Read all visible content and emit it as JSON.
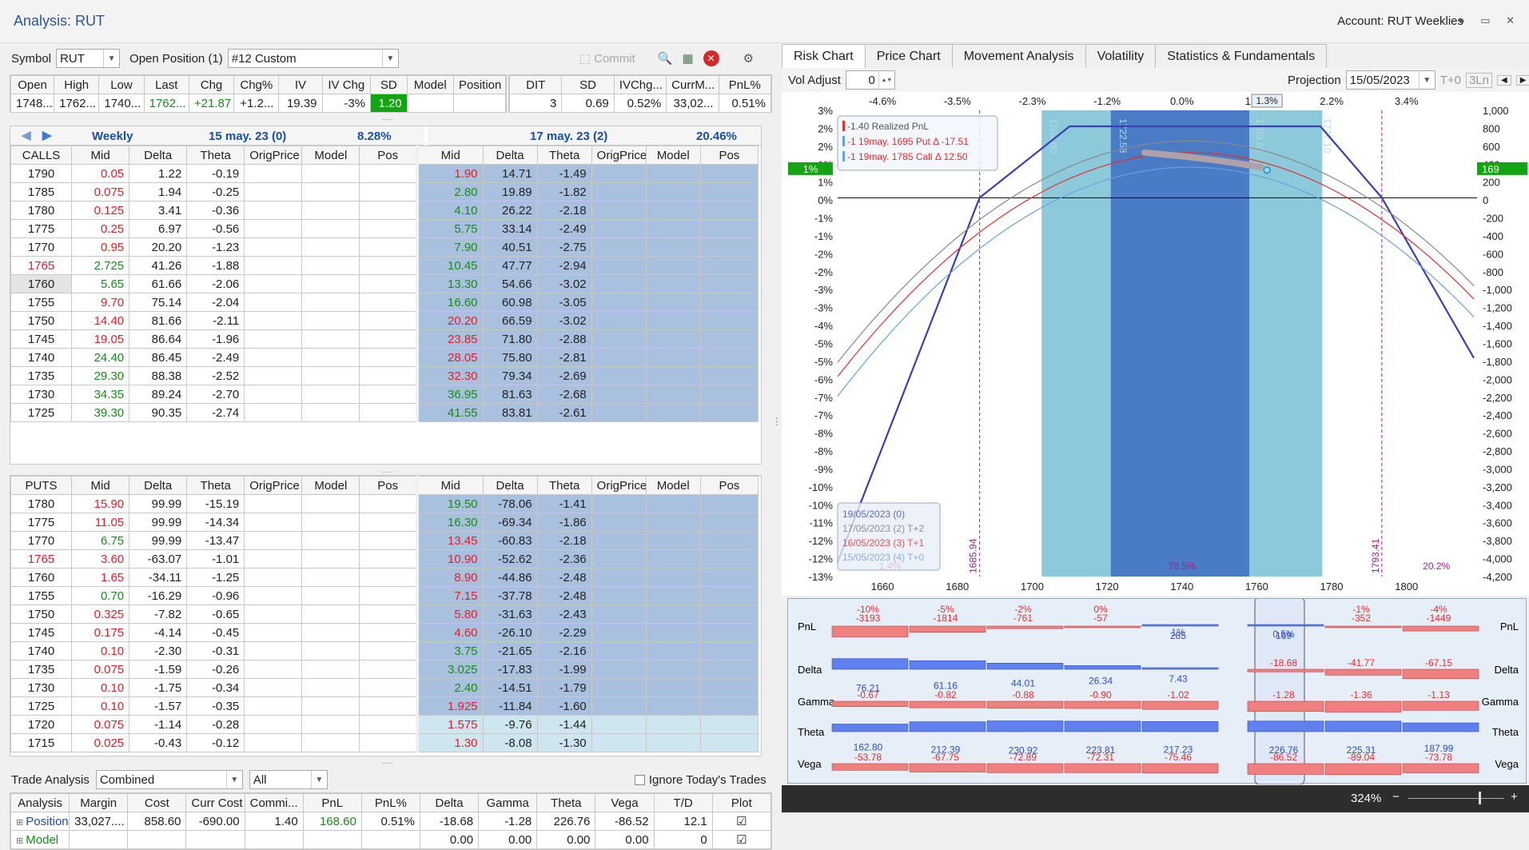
{
  "window": {
    "title": "Analysis: RUT",
    "account": "Account: RUT Weeklies"
  },
  "symbol_bar": {
    "symbol_label": "Symbol",
    "symbol": "RUT",
    "open_pos_label": "Open Position (1)",
    "position": "#12 Custom",
    "commit": "Commit"
  },
  "quote": {
    "headers": [
      "Open",
      "High",
      "Low",
      "Last",
      "Chg",
      "Chg%",
      "IV",
      "IV Chg",
      "SD",
      "Model",
      "Position"
    ],
    "values": [
      "1748...",
      "1762...",
      "1740...",
      "1762...",
      "+21.87",
      "+1.2...",
      "19.39",
      "-3%",
      "1.20",
      "",
      ""
    ]
  },
  "pos_stats": {
    "headers": [
      "DIT",
      "SD",
      "IVChg...",
      "CurrM...",
      "PnL%"
    ],
    "values": [
      "3",
      "0.69",
      "0.52%",
      "33,02...",
      "0.51%"
    ]
  },
  "expiry1": {
    "label": "Weekly",
    "date": "15 may. 23 (0)",
    "iv": "8.28%"
  },
  "expiry2": {
    "date": "17 may. 23 (2)",
    "iv": "20.46%"
  },
  "chain_headers_calls": [
    "CALLS",
    "Mid",
    "Delta",
    "Theta",
    "OrigPrice",
    "Model",
    "Pos"
  ],
  "chain_headers_puts": [
    "PUTS",
    "Mid",
    "Delta",
    "Theta",
    "OrigPrice",
    "Model",
    "Pos"
  ],
  "chain_headers2": [
    "Mid",
    "Delta",
    "Theta",
    "OrigPrice",
    "Model",
    "Pos"
  ],
  "calls": [
    [
      "1790",
      "0.05",
      "1.22",
      "-0.19",
      "1.90",
      "14.71",
      "-1.49"
    ],
    [
      "1785",
      "0.075",
      "1.94",
      "-0.25",
      "2.80",
      "19.89",
      "-1.82"
    ],
    [
      "1780",
      "0.125",
      "3.41",
      "-0.36",
      "4.10",
      "26.22",
      "-2.18"
    ],
    [
      "1775",
      "0.25",
      "6.97",
      "-0.56",
      "5.75",
      "33.14",
      "-2.49"
    ],
    [
      "1770",
      "0.95",
      "20.20",
      "-1.23",
      "7.90",
      "40.51",
      "-2.75"
    ],
    [
      "1765",
      "2.725",
      "41.26",
      "-1.88",
      "10.45",
      "47.77",
      "-2.94"
    ],
    [
      "1760",
      "5.65",
      "61.66",
      "-2.06",
      "13.30",
      "54.66",
      "-3.02"
    ],
    [
      "1755",
      "9.70",
      "75.14",
      "-2.04",
      "16.60",
      "60.98",
      "-3.05"
    ],
    [
      "1750",
      "14.40",
      "81.66",
      "-2.11",
      "20.20",
      "66.59",
      "-3.02"
    ],
    [
      "1745",
      "19.05",
      "86.64",
      "-1.96",
      "23.85",
      "71.80",
      "-2.88"
    ],
    [
      "1740",
      "24.40",
      "86.45",
      "-2.49",
      "28.05",
      "75.80",
      "-2.81"
    ],
    [
      "1735",
      "29.30",
      "88.38",
      "-2.52",
      "32.30",
      "79.34",
      "-2.69"
    ],
    [
      "1730",
      "34.35",
      "89.24",
      "-2.70",
      "36.95",
      "81.63",
      "-2.68"
    ],
    [
      "1725",
      "39.30",
      "90.35",
      "-2.74",
      "41.55",
      "83.81",
      "-2.61"
    ]
  ],
  "calls_colors": [
    "r",
    "r",
    "r",
    "r",
    "r",
    "g",
    "g",
    "r",
    "r",
    "r",
    "g",
    "g",
    "g",
    "g"
  ],
  "calls_colors2": [
    "r",
    "g",
    "g",
    "g",
    "g",
    "g",
    "g",
    "g",
    "r",
    "r",
    "r",
    "r",
    "g",
    "g"
  ],
  "puts": [
    [
      "1780",
      "15.90",
      "99.99",
      "-15.19",
      "19.50",
      "-78.06",
      "-1.41"
    ],
    [
      "1775",
      "11.05",
      "99.99",
      "-14.34",
      "16.30",
      "-69.34",
      "-1.86"
    ],
    [
      "1770",
      "6.75",
      "99.99",
      "-13.47",
      "13.45",
      "-60.83",
      "-2.18"
    ],
    [
      "1765",
      "3.60",
      "-63.07",
      "-1.01",
      "10.90",
      "-52.62",
      "-2.36"
    ],
    [
      "1760",
      "1.65",
      "-34.11",
      "-1.25",
      "8.90",
      "-44.86",
      "-2.48"
    ],
    [
      "1755",
      "0.70",
      "-16.29",
      "-0.96",
      "7.15",
      "-37.78",
      "-2.48"
    ],
    [
      "1750",
      "0.325",
      "-7.82",
      "-0.65",
      "5.80",
      "-31.63",
      "-2.43"
    ],
    [
      "1745",
      "0.175",
      "-4.14",
      "-0.45",
      "4.60",
      "-26.10",
      "-2.29"
    ],
    [
      "1740",
      "0.10",
      "-2.30",
      "-0.31",
      "3.75",
      "-21.65",
      "-2.16"
    ],
    [
      "1735",
      "0.075",
      "-1.59",
      "-0.26",
      "3.025",
      "-17.83",
      "-1.99"
    ],
    [
      "1730",
      "0.10",
      "-1.75",
      "-0.34",
      "2.40",
      "-14.51",
      "-1.79"
    ],
    [
      "1725",
      "0.10",
      "-1.57",
      "-0.35",
      "1.925",
      "-11.84",
      "-1.60"
    ],
    [
      "1720",
      "0.075",
      "-1.14",
      "-0.28",
      "1.575",
      "-9.76",
      "-1.44"
    ],
    [
      "1715",
      "0.025",
      "-0.43",
      "-0.12",
      "1.30",
      "-8.08",
      "-1.30"
    ]
  ],
  "puts_colors": [
    "r",
    "r",
    "g",
    "r",
    "r",
    "g",
    "r",
    "r",
    "r",
    "r",
    "r",
    "r",
    "r",
    "r"
  ],
  "puts_colors2": [
    "g",
    "g",
    "r",
    "r",
    "r",
    "r",
    "r",
    "r",
    "g",
    "g",
    "g",
    "r",
    "r",
    "r"
  ],
  "trade": {
    "label": "Trade Analysis",
    "mode": "Combined",
    "filter": "All",
    "ignore": "Ignore Today's Trades",
    "headers": [
      "Analysis",
      "Margin",
      "Cost",
      "Curr Cost",
      "Commi...",
      "PnL",
      "PnL%",
      "Delta",
      "Gamma",
      "Theta",
      "Vega",
      "T/D",
      "Plot"
    ],
    "position": [
      "Position",
      "33,027....",
      "858.60",
      "-690.00",
      "1.40",
      "168.60",
      "0.51%",
      "-18.68",
      "-1.28",
      "226.76",
      "-86.52",
      "12.1"
    ],
    "model": [
      "Model",
      "",
      "",
      "",
      "",
      "",
      "",
      "0.00",
      "0.00",
      "0.00",
      "0.00",
      "0"
    ]
  },
  "tabs": [
    "Risk Chart",
    "Price Chart",
    "Movement Analysis",
    "Volatility",
    "Statistics & Fundamentals"
  ],
  "vol_adjust": {
    "label": "Vol Adjust",
    "value": "0"
  },
  "projection": {
    "label": "Projection",
    "date": "15/05/2023",
    "t0": "T+0",
    "ln": "3Ln"
  },
  "chart_data": {
    "type": "line",
    "x_ticks": [
      "1660",
      "1680",
      "1700",
      "1720",
      "1740",
      "1760",
      "1780",
      "1800"
    ],
    "top_pct": [
      "-4.6%",
      "-3.5%",
      "-2.3%",
      "-1.2%",
      "0.0%",
      "1.1%",
      "2.2%",
      "3.4%"
    ],
    "top_marker": "1.3%",
    "y_left": [
      "3%",
      "2%",
      "2%",
      "1%",
      "1%",
      "0%",
      "-1%",
      "-1%",
      "-2%",
      "-2%",
      "-3%",
      "-3%",
      "-4%",
      "-5%",
      "-5%",
      "-6%",
      "-7%",
      "-7%",
      "-8%",
      "-8%",
      "-9%",
      "-10%",
      "-10%",
      "-11%",
      "-12%",
      "-12%",
      "-13%"
    ],
    "y_right": [
      "1,000",
      "800",
      "600",
      "400",
      "200",
      "0",
      "-200",
      "-400",
      "-600",
      "-800",
      "-1,000",
      "-1,200",
      "-1,400",
      "-1,600",
      "-1,800",
      "-2,000",
      "-2,200",
      "-2,400",
      "-2,600",
      "-2,800",
      "-3,000",
      "-3,200",
      "-3,400",
      "-3,600",
      "-3,800",
      "-4,000",
      "-4,200"
    ],
    "left_badge": "1%",
    "right_badge": "169",
    "x_marker": "1762.72",
    "band_labels": [
      "1704.00",
      "1722.58",
      "1759.02",
      "1777.10"
    ],
    "breakevens": [
      "1685.94",
      "1793.41"
    ],
    "probs": [
      "1.4%",
      "78.5%",
      "20.2%"
    ],
    "legend1": [
      {
        "text": "-1.40 Realized PnL",
        "color": "#e03030"
      },
      {
        "text": "-1 19may. 1695 Put Δ   -17.51",
        "color": "#e03030"
      },
      {
        "text": "-1 19may. 1785 Call Δ   12.50",
        "color": "#e03030"
      }
    ],
    "legend2": [
      {
        "text": "19/05/2023 (0)",
        "color": "#3a4fb0"
      },
      {
        "text": "17/05/2023 (2) T+2",
        "color": "#777"
      },
      {
        "text": "16/05/2023 (3) T+1",
        "color": "#e03030"
      },
      {
        "text": "15/05/2023 (4) T+0",
        "color": "#6aa0e0"
      }
    ],
    "series": [
      {
        "name": "19/05/2023 (0)",
        "x": [
          1648,
          1685.94,
          1710,
          1777,
          1793.41,
          1818
        ],
        "y": [
          -12.5,
          0,
          2.45,
          2.45,
          0,
          -5.5
        ]
      },
      {
        "name": "17/05/2023 (2) T+2",
        "x": [
          1648,
          1680,
          1700,
          1720,
          1740,
          1760,
          1780,
          1800,
          1818
        ],
        "y": [
          -11.8,
          -1.8,
          0.6,
          1.7,
          1.9,
          1.5,
          0.4,
          -2.0,
          -5.2
        ]
      }
    ]
  },
  "stats": {
    "pct_labels": [
      "-10%",
      "-5%",
      "-2%",
      "0%",
      "",
      "",
      "-1%",
      "-4%"
    ],
    "pnl": [
      "-3193",
      "-1814",
      "-761",
      "-57",
      "285",
      "169",
      "-352",
      "-1449"
    ],
    "pnl_sub": [
      "",
      "",
      "",
      "",
      "1%",
      "0.5%",
      "",
      ""
    ],
    "delta": [
      "76.21",
      "61.16",
      "44.01",
      "26.34",
      "7.43",
      "-18.68",
      "-41.77",
      "-67.15"
    ],
    "gamma": [
      "-0.67",
      "-0.82",
      "-0.88",
      "-0.90",
      "-1.02",
      "-1.28",
      "-1.36",
      "-1.13"
    ],
    "theta": [
      "162.80",
      "212.39",
      "230.92",
      "223.81",
      "217.23",
      "226.76",
      "225.31",
      "187.99"
    ],
    "vega": [
      "-53.78",
      "-67.75",
      "-72.89",
      "-72.31",
      "-75.46",
      "-86.52",
      "-89.04",
      "-73.78"
    ],
    "row_names": [
      "PnL",
      "Delta",
      "Gamma",
      "Theta",
      "Vega"
    ]
  },
  "zoom": "324%"
}
